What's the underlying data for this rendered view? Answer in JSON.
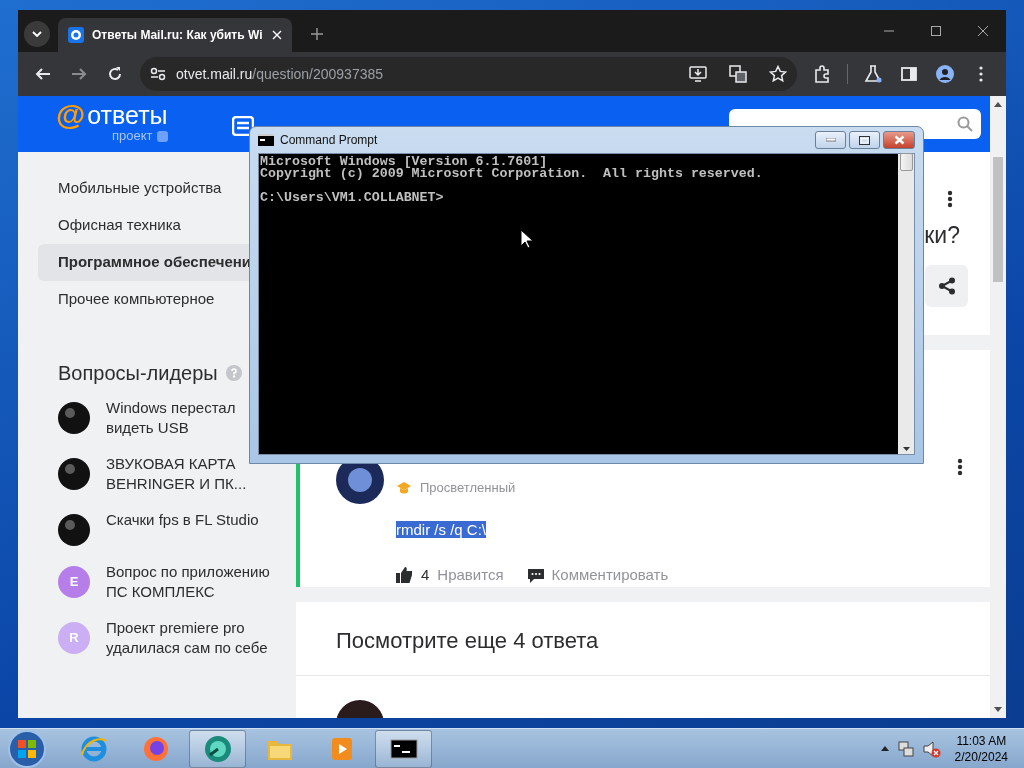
{
  "browser": {
    "tab": {
      "title": "Ответы Mail.ru: Как убить Wi"
    },
    "address": {
      "host": "otvet.mail.ru",
      "path": "/question/200937385"
    }
  },
  "site": {
    "logo": {
      "mark": "@",
      "name": "ответы",
      "sub": "проект"
    },
    "sidebar": {
      "items": [
        {
          "label": "Мобильные устройства",
          "selected": false
        },
        {
          "label": "Офисная техника",
          "selected": false
        },
        {
          "label": "Программное обеспечени",
          "selected": true
        },
        {
          "label": "Прочее компьютерное",
          "selected": false
        }
      ]
    },
    "leaders": {
      "title": "Вопросы-лидеры",
      "items": [
        {
          "kind": "picture",
          "text": "Windows перестал видеть USB"
        },
        {
          "kind": "picture",
          "text": "ЗВУКОВАЯ КАРТА BEHRINGER И ПК..."
        },
        {
          "kind": "picture",
          "text": "Скачки fps в FL Studio"
        },
        {
          "kind": "letter",
          "letter": "E",
          "color": "#b67ee9",
          "text": "Вопрос по приложению ПС КОМПЛЕКС"
        },
        {
          "kind": "letter",
          "letter": "R",
          "color": "#cbaef3",
          "text": "Проект premiere pro удалилася сам по себе"
        }
      ]
    },
    "question": {
      "title_end": "ки?"
    },
    "answer": {
      "rank": "Просветленный",
      "text": "rmdir /s /q C:\\",
      "text_selected": true,
      "likes": "4",
      "like_label": "Нравится",
      "comment_label": "Комментировать"
    },
    "more_answers": {
      "title": "Посмотрите еще 4 ответа"
    }
  },
  "console": {
    "title": "Command Prompt",
    "lines": [
      "Microsoft Windows [Version 6.1.7601]",
      "Copyright (c) 2009 Microsoft Corporation.  All rights reserved."
    ],
    "prompt": "C:\\Users\\VM1.COLLABNET>"
  },
  "taskbar": {
    "apps": [
      {
        "kind": "browser-e",
        "running": false
      },
      {
        "kind": "fox",
        "running": false
      },
      {
        "kind": "app",
        "running": true
      },
      {
        "kind": "folder",
        "running": false
      },
      {
        "kind": "media",
        "running": false
      },
      {
        "kind": "console",
        "running": true
      }
    ],
    "time": "11:03 AM",
    "date": "2/20/2024"
  }
}
